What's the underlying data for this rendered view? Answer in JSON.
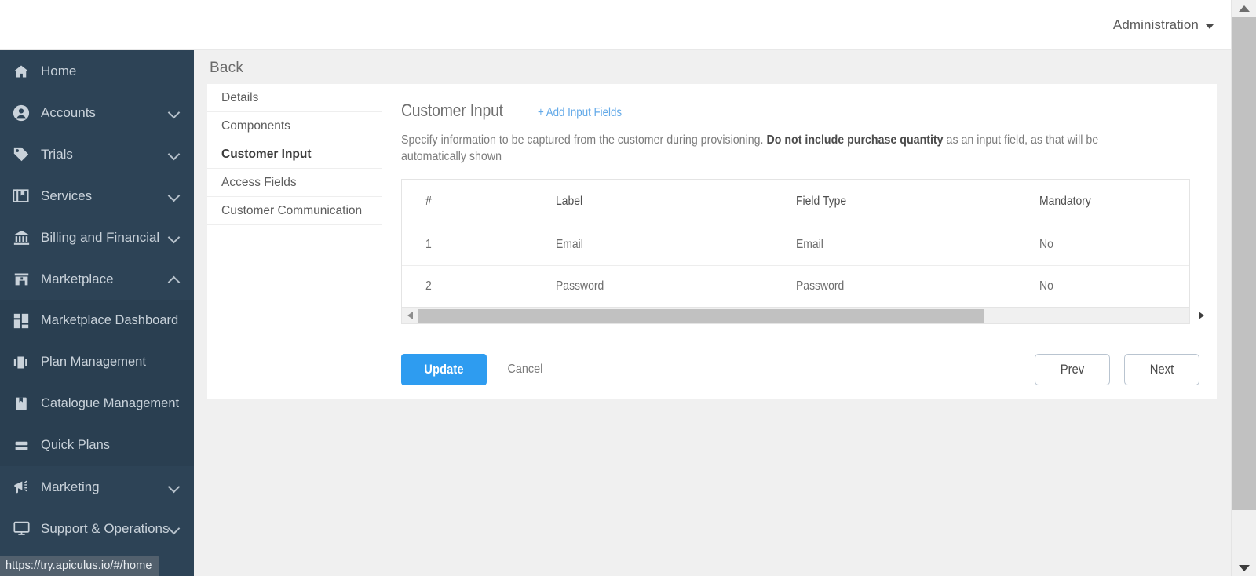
{
  "header": {
    "user_menu_label": "Administration"
  },
  "sidebar": {
    "items": [
      {
        "label": "Home",
        "icon": "home-icon",
        "expandable": false
      },
      {
        "label": "Accounts",
        "icon": "account-icon",
        "expandable": true,
        "expanded": false
      },
      {
        "label": "Trials",
        "icon": "tag-icon",
        "expandable": true,
        "expanded": false
      },
      {
        "label": "Services",
        "icon": "services-icon",
        "expandable": true,
        "expanded": false
      },
      {
        "label": "Billing and Financial",
        "icon": "bank-icon",
        "expandable": true,
        "expanded": false
      },
      {
        "label": "Marketplace",
        "icon": "storefront-icon",
        "expandable": true,
        "expanded": true
      },
      {
        "label": "Marketing",
        "icon": "megaphone-icon",
        "expandable": true,
        "expanded": false
      },
      {
        "label": "Support & Operations",
        "icon": "monitor-icon",
        "expandable": true,
        "expanded": false
      }
    ],
    "marketplace_submenu": [
      {
        "label": "Marketplace Dashboard",
        "icon": "dashboard-icon"
      },
      {
        "label": "Plan Management",
        "icon": "plan-icon"
      },
      {
        "label": "Catalogue Management",
        "icon": "catalogue-icon"
      },
      {
        "label": "Quick Plans",
        "icon": "quickplans-icon"
      }
    ]
  },
  "status_bar": {
    "url": "https://try.apiculus.io/#/home"
  },
  "content": {
    "back_label": "Back",
    "tabs": [
      {
        "label": "Details",
        "active": false
      },
      {
        "label": "Components",
        "active": false
      },
      {
        "label": "Customer Input",
        "active": true
      },
      {
        "label": "Access Fields",
        "active": false
      },
      {
        "label": "Customer Communication",
        "active": false
      }
    ],
    "panel": {
      "title": "Customer Input",
      "add_fields_label": "+ Add Input Fields",
      "description_before": "Specify information to be captured from the customer during provisioning. ",
      "description_bold": "Do not include purchase quantity",
      "description_after": " as an input field, as that will be automatically shown",
      "table": {
        "columns": [
          "#",
          "Label",
          "Field Type",
          "Mandatory"
        ],
        "rows": [
          {
            "num": "1",
            "label": "Email",
            "field_type": "Email",
            "mandatory": "No"
          },
          {
            "num": "2",
            "label": "Password",
            "field_type": "Password",
            "mandatory": "No"
          }
        ]
      },
      "actions": {
        "update_label": "Update",
        "cancel_label": "Cancel",
        "prev_label": "Prev",
        "next_label": "Next"
      }
    }
  },
  "colors": {
    "sidebar_bg": "#2d4356",
    "submenu_bg": "#2a3f51",
    "primary_blue": "#2e9cf0",
    "link_blue": "#62a9e8",
    "page_bg": "#f0f0f0"
  }
}
